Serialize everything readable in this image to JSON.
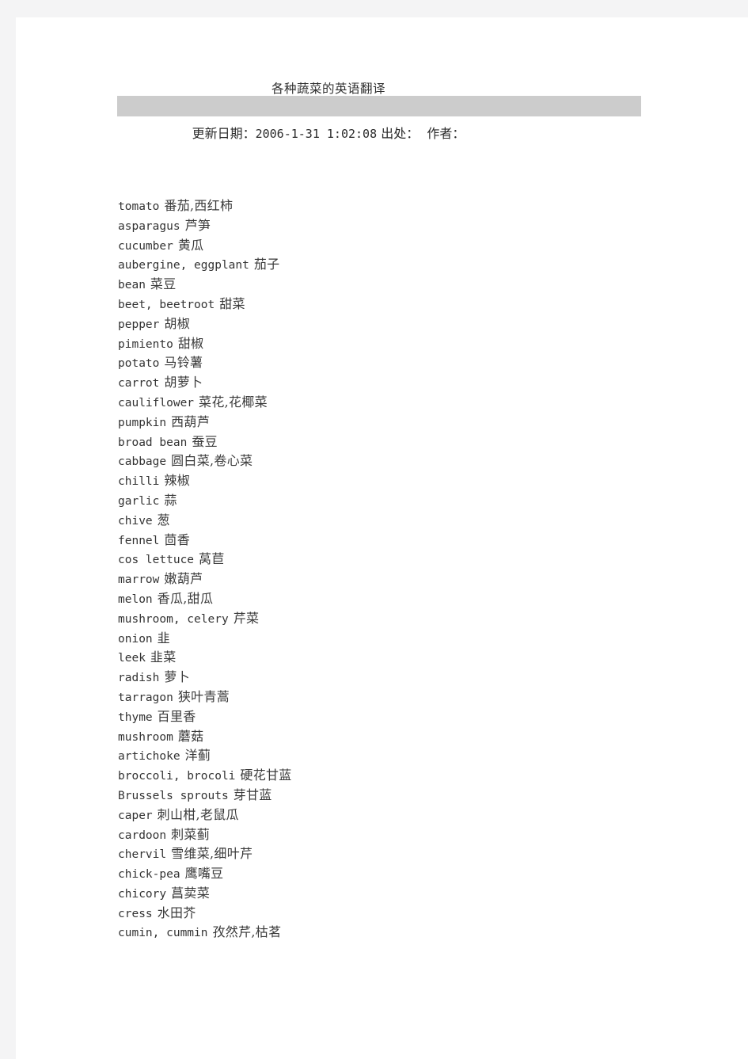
{
  "page": {
    "title": "各种蔬菜的英语翻译",
    "rule_color": "#cccccc",
    "background": "#ffffff"
  },
  "meta": {
    "update_label": "更新日期：",
    "update_value": "2006-1-31 1:02:08",
    "source_label": "出处：",
    "author_label": "作者："
  },
  "list": {
    "items": [
      {
        "en": "tomato",
        "zh": "番茄,西红柿"
      },
      {
        "en": "asparagus",
        "zh": "芦笋"
      },
      {
        "en": "cucumber",
        "zh": "黄瓜"
      },
      {
        "en": "aubergine, eggplant",
        "zh": "茄子"
      },
      {
        "en": "bean",
        "zh": "菜豆"
      },
      {
        "en": "beet, beetroot",
        "zh": "甜菜"
      },
      {
        "en": "pepper",
        "zh": "胡椒"
      },
      {
        "en": "pimiento",
        "zh": "甜椒"
      },
      {
        "en": "potato",
        "zh": "马铃薯"
      },
      {
        "en": "carrot",
        "zh": "胡萝卜"
      },
      {
        "en": "cauliflower",
        "zh": "菜花,花椰菜"
      },
      {
        "en": "pumpkin",
        "zh": "西葫芦"
      },
      {
        "en": "broad bean",
        "zh": "蚕豆"
      },
      {
        "en": "cabbage",
        "zh": "圆白菜,卷心菜"
      },
      {
        "en": "chilli",
        "zh": "辣椒"
      },
      {
        "en": "garlic",
        "zh": "蒜"
      },
      {
        "en": "chive",
        "zh": "葱"
      },
      {
        "en": "fennel",
        "zh": "茴香"
      },
      {
        "en": "cos lettuce",
        "zh": "莴苣"
      },
      {
        "en": "marrow",
        "zh": "嫩葫芦"
      },
      {
        "en": "melon",
        "zh": "香瓜,甜瓜"
      },
      {
        "en": "mushroom, celery",
        "zh": "芹菜"
      },
      {
        "en": "onion",
        "zh": "韭"
      },
      {
        "en": "leek",
        "zh": "韭菜"
      },
      {
        "en": "radish",
        "zh": "萝卜"
      },
      {
        "en": "tarragon",
        "zh": "狭叶青蒿"
      },
      {
        "en": "thyme",
        "zh": "百里香"
      },
      {
        "en": "mushroom",
        "zh": "蘑菇"
      },
      {
        "en": "artichoke",
        "zh": "洋蓟"
      },
      {
        "en": "broccoli, brocoli",
        "zh": "硬花甘蓝"
      },
      {
        "en": "Brussels sprouts",
        "zh": "芽甘蓝"
      },
      {
        "en": "caper",
        "zh": "刺山柑,老鼠瓜"
      },
      {
        "en": "cardoon",
        "zh": "刺菜蓟"
      },
      {
        "en": "chervil",
        "zh": "雪维菜,细叶芹"
      },
      {
        "en": "chick-pea",
        "zh": "鹰嘴豆"
      },
      {
        "en": "chicory",
        "zh": "菖荬菜"
      },
      {
        "en": "cress",
        "zh": "水田芥"
      },
      {
        "en": "cumin, cummin",
        "zh": "孜然芹,枯茗"
      }
    ]
  }
}
